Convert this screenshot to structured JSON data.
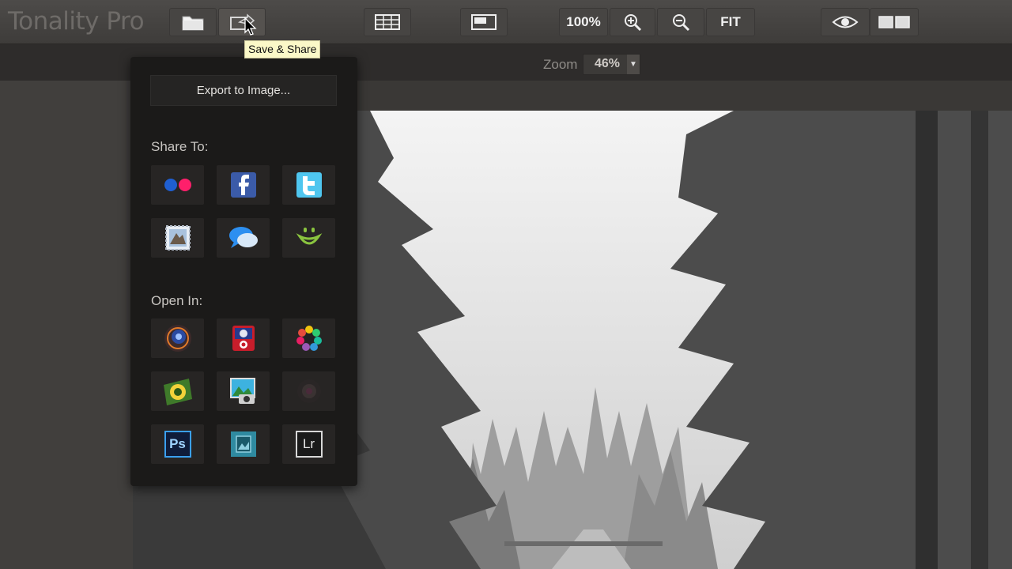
{
  "app": {
    "title": "Tonality Pro"
  },
  "toolbar": {
    "zoom_100_label": "100%",
    "fit_label": "FIT",
    "tooltip": "Save & Share"
  },
  "zoom": {
    "label": "Zoom",
    "value": "46%"
  },
  "menu": {
    "export_label": "Export to Image...",
    "share_title": "Share To:",
    "open_title": "Open In:",
    "share_items": [
      {
        "name": "flickr-icon"
      },
      {
        "name": "facebook-icon"
      },
      {
        "name": "twitter-icon"
      },
      {
        "name": "mail-stamp-icon"
      },
      {
        "name": "messages-icon"
      },
      {
        "name": "smugmug-icon"
      }
    ],
    "open_items": [
      {
        "name": "lens-app-icon",
        "label": ""
      },
      {
        "name": "photo-booth-icon",
        "label": ""
      },
      {
        "name": "color-wheel-icon",
        "label": ""
      },
      {
        "name": "aperture-icon",
        "label": ""
      },
      {
        "name": "iphoto-icon",
        "label": ""
      },
      {
        "name": "camera-lens-icon",
        "label": ""
      },
      {
        "name": "photoshop-icon",
        "label": "Ps"
      },
      {
        "name": "preview-icon",
        "label": ""
      },
      {
        "name": "lightroom-icon",
        "label": "Lr"
      }
    ]
  }
}
